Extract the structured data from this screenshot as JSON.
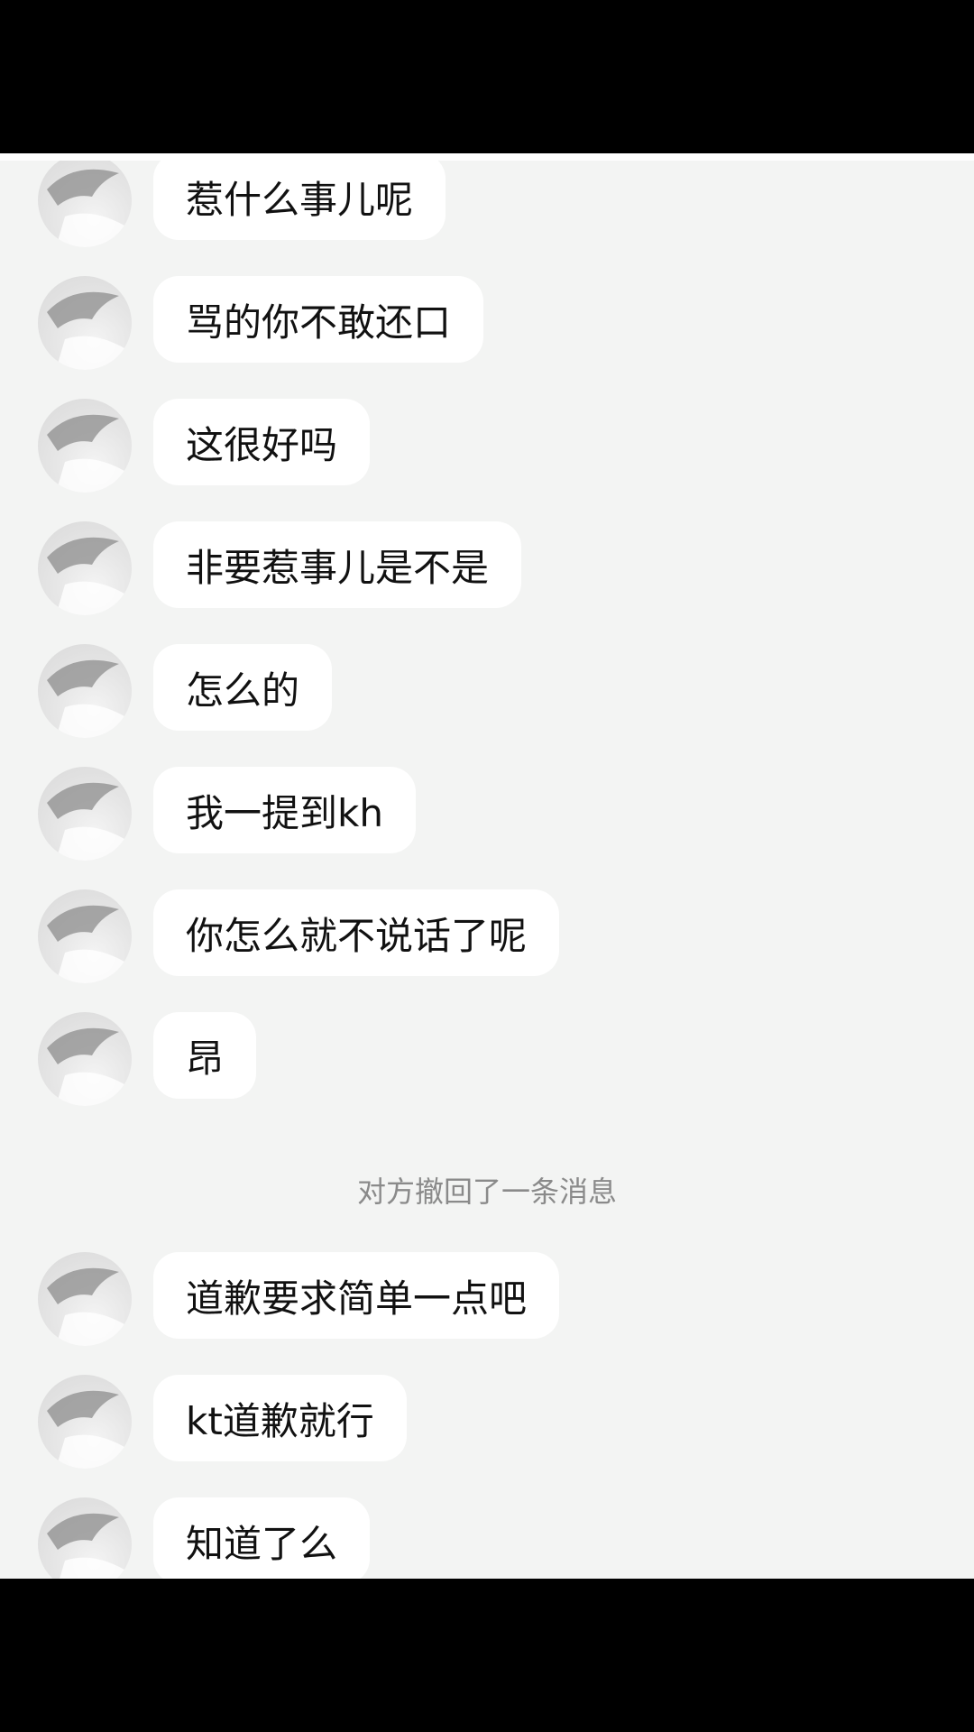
{
  "messages_before": [
    {
      "text": "惹什么事儿呢"
    },
    {
      "text": "骂的你不敢还口"
    },
    {
      "text": "这很好吗"
    },
    {
      "text": "非要惹事儿是不是"
    },
    {
      "text": "怎么的"
    },
    {
      "text": "我一提到kh"
    },
    {
      "text": "你怎么就不说话了呢"
    },
    {
      "text": "昂"
    }
  ],
  "system_note": "对方撤回了一条消息",
  "messages_after": [
    {
      "text": "道歉要求简单一点吧"
    },
    {
      "text": "kt道歉就行"
    },
    {
      "text": "知道了么"
    }
  ],
  "avatar_icon": "user-avatar-icon",
  "colors": {
    "chat_background": "#f3f4f3",
    "bubble": "#ffffff",
    "frame": "#000000"
  }
}
